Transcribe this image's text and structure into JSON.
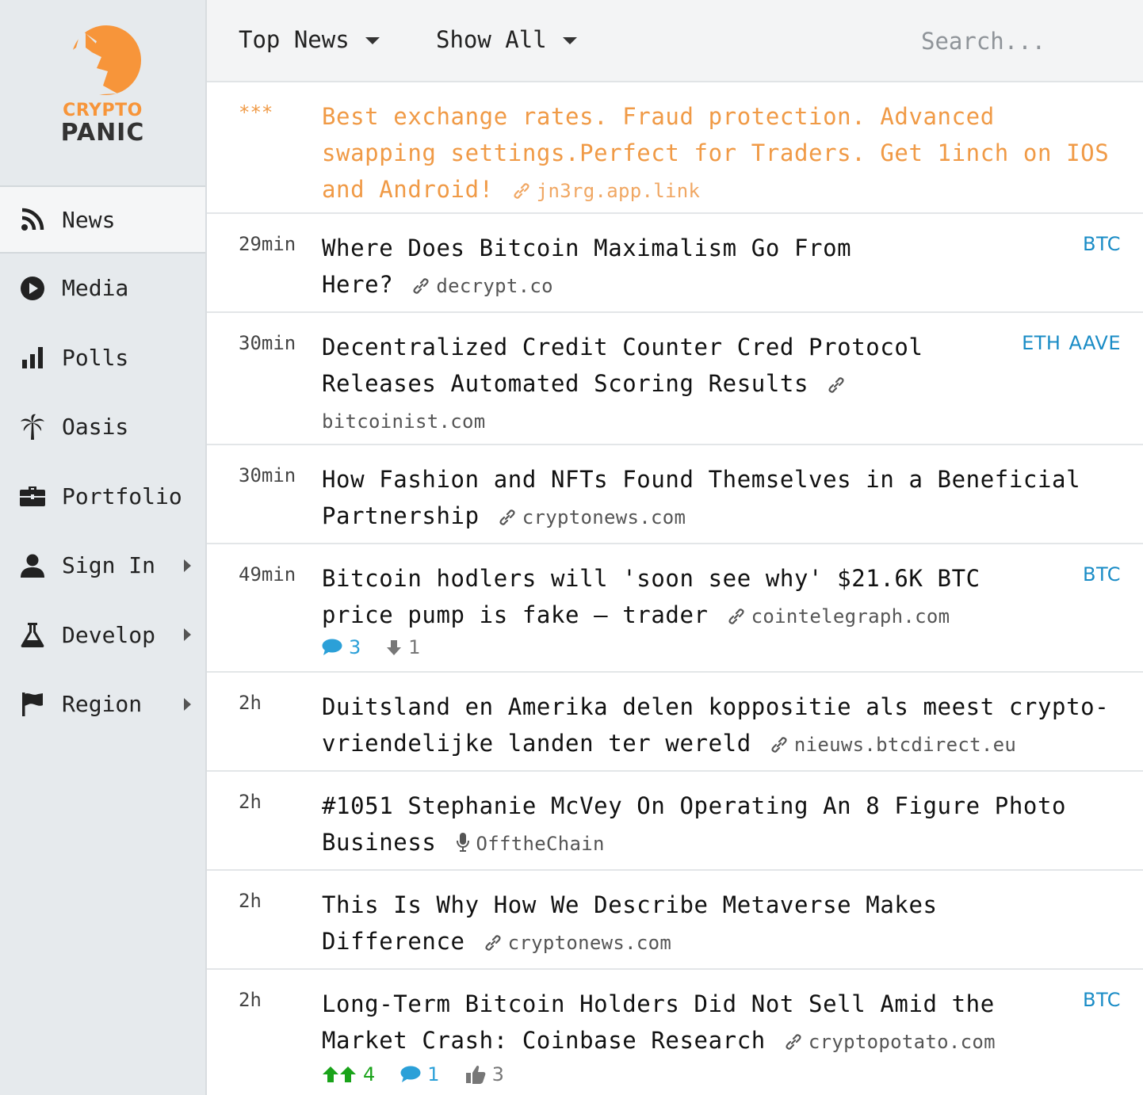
{
  "brand": {
    "line1": "CRYPTO",
    "line2": "PANIC",
    "accent": "#f7953a"
  },
  "sidebar": {
    "items": [
      {
        "label": "News",
        "icon": "rss-icon",
        "active": true
      },
      {
        "label": "Media",
        "icon": "play-circle-icon"
      },
      {
        "label": "Polls",
        "icon": "bar-chart-icon"
      },
      {
        "label": "Oasis",
        "icon": "palm-tree-icon"
      },
      {
        "label": "Portfolio",
        "icon": "briefcase-icon"
      },
      {
        "label": "Sign In",
        "icon": "user-icon",
        "submenu": true
      },
      {
        "label": "Develop",
        "icon": "flask-icon",
        "submenu": true
      },
      {
        "label": "Region",
        "icon": "flag-icon",
        "submenu": true
      }
    ]
  },
  "header": {
    "filter1": "Top News",
    "filter2": "Show All",
    "search_placeholder": "Search..."
  },
  "news": [
    {
      "time": "***",
      "title": "Best exchange rates. Fraud protection. Advanced swapping settings.Perfect for Traders. Get 1inch on IOS and Android!",
      "source": "jn3rg.app.link",
      "tags": [],
      "sponsored": true
    },
    {
      "time": "29min",
      "title": "Where Does Bitcoin Maximalism Go From Here?",
      "source": "decrypt.co",
      "tags": [
        "BTC"
      ]
    },
    {
      "time": "30min",
      "title": "Decentralized Credit Counter Cred Protocol Releases Automated Scoring Results",
      "source": "bitcoinist.com",
      "tags": [
        "ETH",
        "AAVE"
      ]
    },
    {
      "time": "30min",
      "title": "How Fashion and NFTs Found Themselves in a Beneficial Partnership",
      "source": "cryptonews.com",
      "tags": []
    },
    {
      "time": "49min",
      "title": "Bitcoin hodlers will 'soon see why' $21.6K BTC price pump is fake — trader",
      "source": "cointelegraph.com",
      "tags": [
        "BTC"
      ],
      "votes": {
        "comments": "3",
        "down": "1"
      }
    },
    {
      "time": "2h",
      "title": "Duitsland en Amerika delen koppositie als meest crypto-vriendelijke landen ter wereld",
      "source": "nieuws.btcdirect.eu",
      "tags": []
    },
    {
      "time": "2h",
      "title": "#1051 Stephanie McVey On Operating An 8 Figure Photo Business",
      "source": "OfftheChain",
      "tags": [],
      "media": true
    },
    {
      "time": "2h",
      "title": "This Is Why How We Describe Metaverse Makes Difference",
      "source": "cryptonews.com",
      "tags": []
    },
    {
      "time": "2h",
      "title": "Long-Term Bitcoin Holders Did Not Sell Amid the Market Crash: Coinbase Research",
      "source": "cryptopotato.com",
      "tags": [
        "BTC"
      ],
      "votes": {
        "bullish": "4",
        "comments": "1",
        "liked": "3"
      }
    }
  ]
}
